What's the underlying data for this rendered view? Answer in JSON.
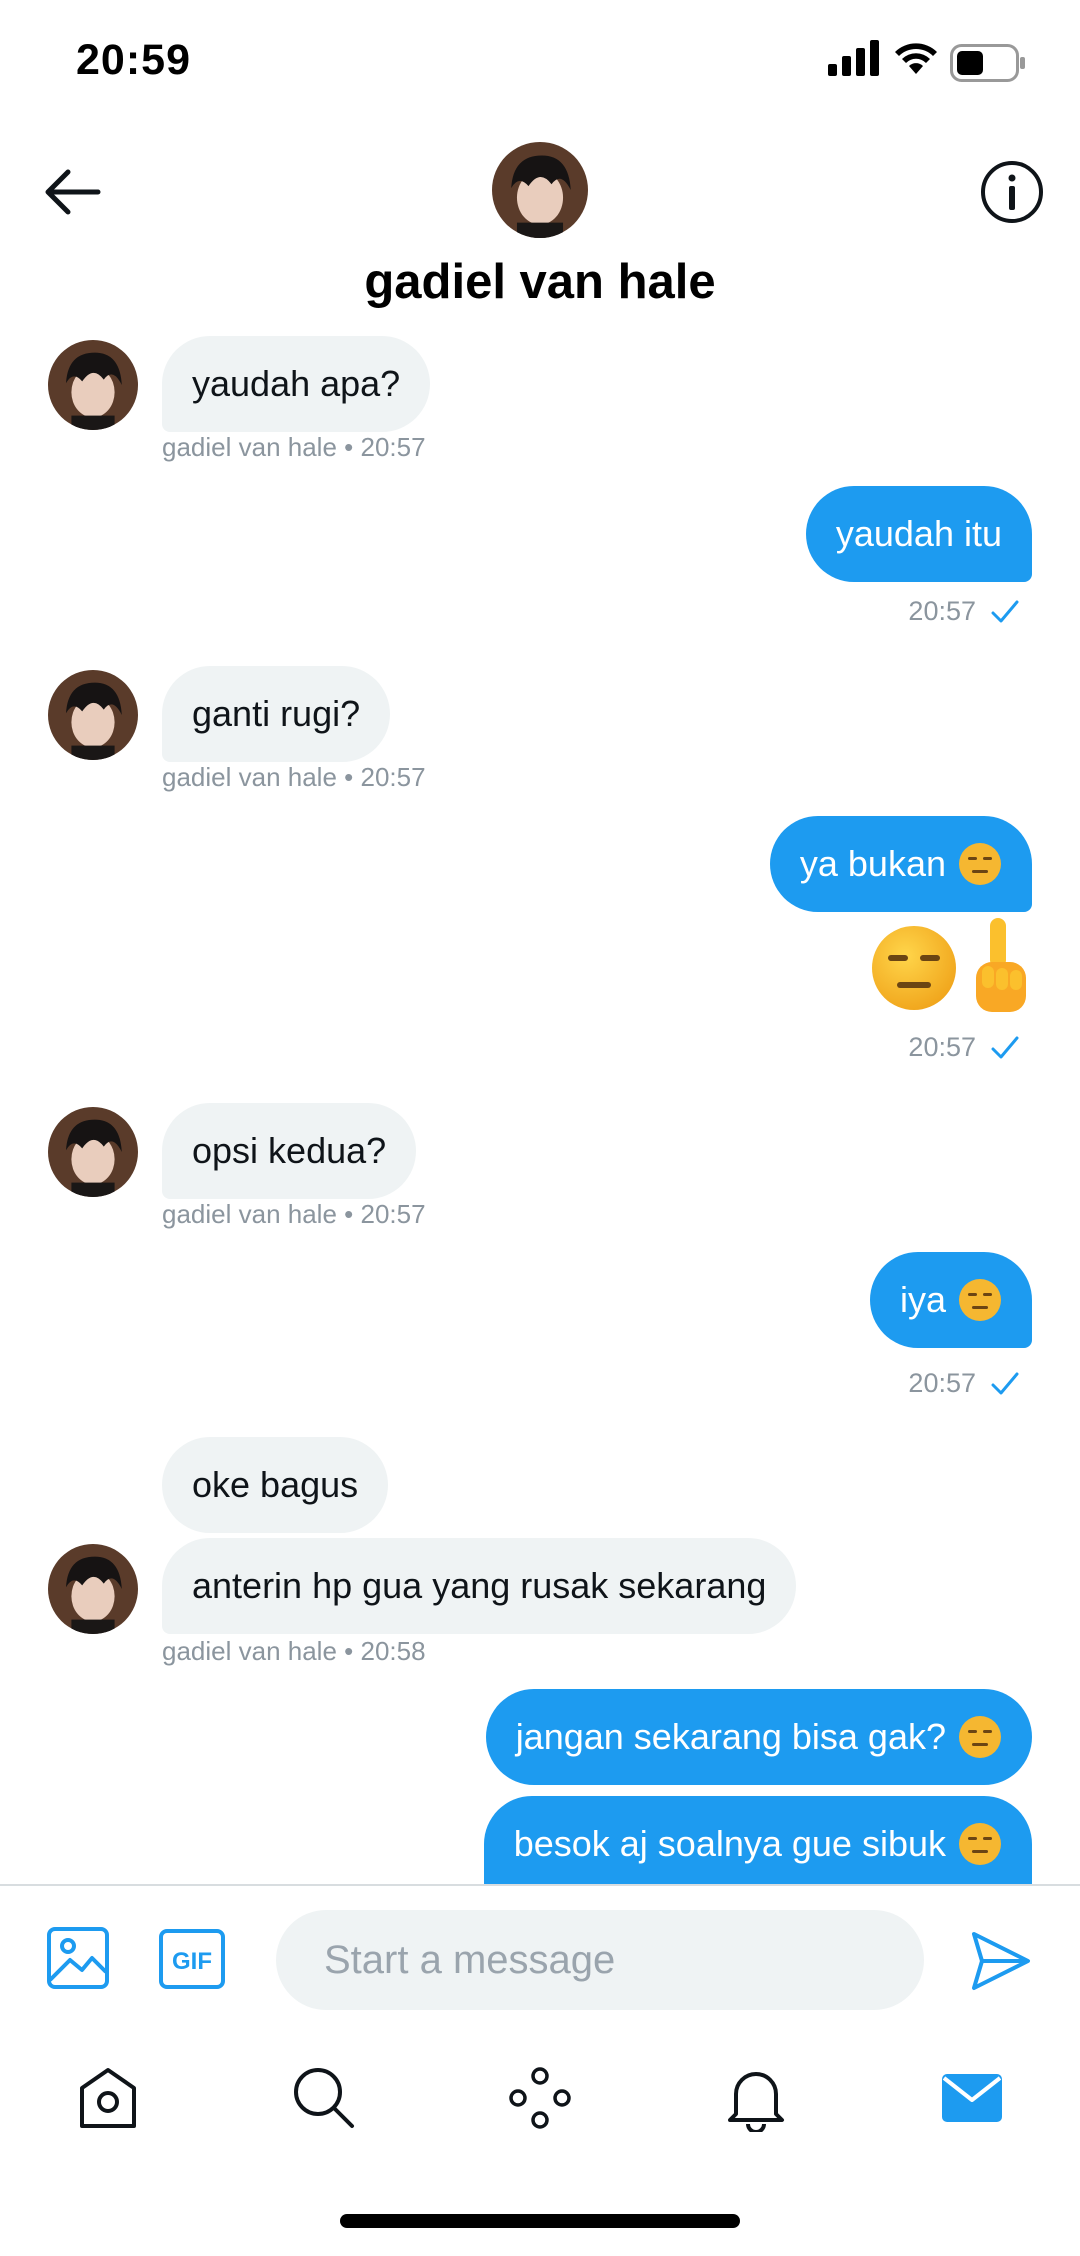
{
  "status_bar": {
    "time": "20:59"
  },
  "header": {
    "contact_name": "gadiel van hale"
  },
  "messages": [
    {
      "text": "yaudah apa?",
      "meta_name": "gadiel van hale",
      "meta_time": "• 20:57"
    },
    {
      "text": "yaudah itu",
      "time": "20:57"
    },
    {
      "text": "ganti rugi?",
      "meta_name": "gadiel van hale",
      "meta_time": "• 20:57"
    },
    {
      "text": "ya bukan",
      "time": "20:57"
    },
    {
      "text": "opsi kedua?",
      "meta_name": "gadiel van hale",
      "meta_time": "• 20:57"
    },
    {
      "text": "iya",
      "time": "20:57"
    },
    {
      "text": "oke bagus"
    },
    {
      "text": "anterin hp gua yang rusak sekarang",
      "meta_name": "gadiel van hale",
      "meta_time": "• 20:58"
    },
    {
      "text": "jangan sekarang bisa gak?"
    },
    {
      "text": "besok aj soalnya gue sibuk"
    }
  ],
  "composer": {
    "placeholder": "Start a message",
    "gif_label": "GIF"
  },
  "icons": {
    "emoji_expressionless": "expressionless-face",
    "emoji_pointing_up": "index-pointing-up",
    "nav": [
      "home-icon",
      "search-icon",
      "spaces-icon",
      "notifications-icon",
      "messages-icon"
    ]
  },
  "colors": {
    "accent": "#1d9bf0",
    "incoming_bubble": "#eff3f4",
    "meta_text": "#8b959e"
  }
}
